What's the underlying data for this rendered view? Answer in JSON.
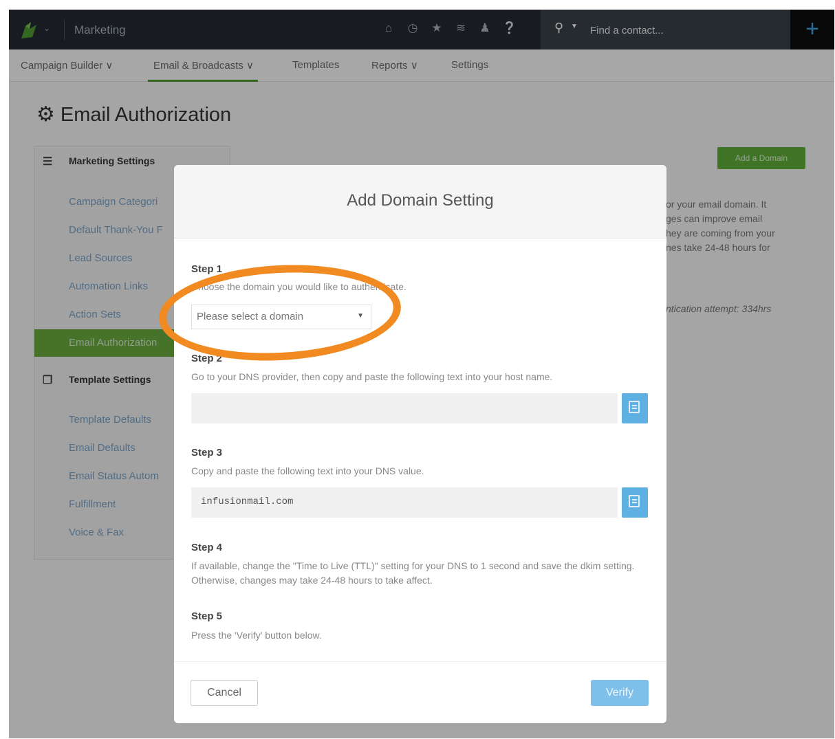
{
  "topbar": {
    "app_title": "Marketing",
    "icons": [
      "home-icon",
      "clock-icon",
      "star-icon",
      "tag-icon",
      "user-icon",
      "help-icon"
    ],
    "search_placeholder": "Find a contact...",
    "add_label": "+"
  },
  "nav": {
    "items": [
      {
        "label": "Campaign Builder ∨"
      },
      {
        "label": "Email & Broadcasts ∨"
      },
      {
        "label": "Templates"
      },
      {
        "label": "Reports ∨"
      },
      {
        "label": "Settings"
      }
    ]
  },
  "page": {
    "title": "Email Authorization"
  },
  "sidebar": {
    "marketing_heading": "Marketing Settings",
    "marketing_items": [
      "Campaign Categori",
      "Default Thank-You F",
      "Lead Sources",
      "Automation Links",
      "Action Sets",
      "Email Authorization"
    ],
    "template_heading": "Template Settings",
    "template_items": [
      "Template Defaults",
      "Email Defaults",
      "Email Status Autom",
      "Fulfillment",
      "Voice & Fax"
    ]
  },
  "background": {
    "add_domain_label": "Add a Domain",
    "info_lines": [
      "or your email domain. It",
      "ges can improve email",
      "hey are coming from your",
      "nes take 24-48 hours for"
    ],
    "last_attempt": "ntication attempt: 334hrs"
  },
  "modal": {
    "title": "Add Domain Setting",
    "step1_title": "Step 1",
    "step1_desc": "Choose the domain you would like to authenticate.",
    "select_value": "Please select a domain",
    "step2_title": "Step 2",
    "step2_desc": "Go to your DNS provider, then copy and paste the following text into your host name.",
    "step2_code": "",
    "step3_title": "Step 3",
    "step3_desc": "Copy and paste the following text into your DNS value.",
    "step3_code": "infusionmail.com",
    "step4_title": "Step 4",
    "step4_desc": "If available, change the \"Time to Live (TTL)\" setting for your DNS to 1 second and save the dkim setting. Otherwise, changes may take 24-48 hours to take affect.",
    "step5_title": "Step 5",
    "step5_desc": "Press the 'Verify' button below.",
    "cancel_label": "Cancel",
    "verify_label": "Verify"
  },
  "colors": {
    "topbar": "#242b33",
    "brand_green": "#5fae39",
    "accent_blue": "#5fb0e3",
    "annotation_orange": "#f08a21"
  }
}
